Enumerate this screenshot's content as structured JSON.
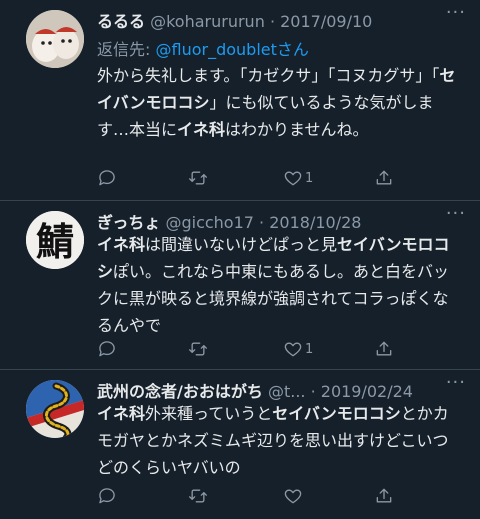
{
  "tweets": [
    {
      "name": "るるる",
      "handle": "@koharururun",
      "separator": "·",
      "date": "2017/09/10",
      "reply_label": "返信先:",
      "reply_handle": "@fluor_doublet",
      "reply_suffix": "さん",
      "body": [
        {
          "t": "外から失礼します。「カゼクサ」「コヌカグサ」「",
          "b": false
        },
        {
          "t": "セイバンモロコシ",
          "b": true
        },
        {
          "t": "」にも似ているような気がします…本当に",
          "b": false
        },
        {
          "t": "イネ科",
          "b": true
        },
        {
          "t": "はわかりませんね。",
          "b": false
        }
      ],
      "reply_count": "",
      "retweet_count": "",
      "like_count": "1"
    },
    {
      "name": "ぎっちょ",
      "handle": "@giccho17",
      "separator": "·",
      "date": "2018/10/28",
      "avatar_char": "鯖",
      "body": [
        {
          "t": "イネ科",
          "b": true
        },
        {
          "t": "は間違いないけどぱっと見",
          "b": false
        },
        {
          "t": "セイバンモロコシ",
          "b": true
        },
        {
          "t": "ぽい。これなら中東にもあるし。あと白をバックに黒が映ると境界線が強調されてコラっぽくなるんやで",
          "b": false
        }
      ],
      "reply_count": "",
      "retweet_count": "",
      "like_count": "1"
    },
    {
      "name": "武州の念者/おおはがち",
      "handle": "@t...",
      "separator": "·",
      "date": "2019/02/24",
      "body": [
        {
          "t": "イネ科",
          "b": true
        },
        {
          "t": "外来種っていうと",
          "b": false
        },
        {
          "t": "セイバンモロコシ",
          "b": true
        },
        {
          "t": "とかカモガヤとかネズミムギ辺りを思い出すけどこいつどのくらいヤバいの",
          "b": false
        }
      ],
      "reply_count": "",
      "retweet_count": "",
      "like_count": ""
    }
  ],
  "icons": {
    "more": "more-icon",
    "reply": "reply-icon",
    "retweet": "retweet-icon",
    "like": "heart-icon",
    "share": "share-icon"
  },
  "colors": {
    "background": "#15202b",
    "text": "#e7e9ea",
    "muted": "#8b98a5",
    "link": "#1d9bf0",
    "divider": "#38444d"
  }
}
